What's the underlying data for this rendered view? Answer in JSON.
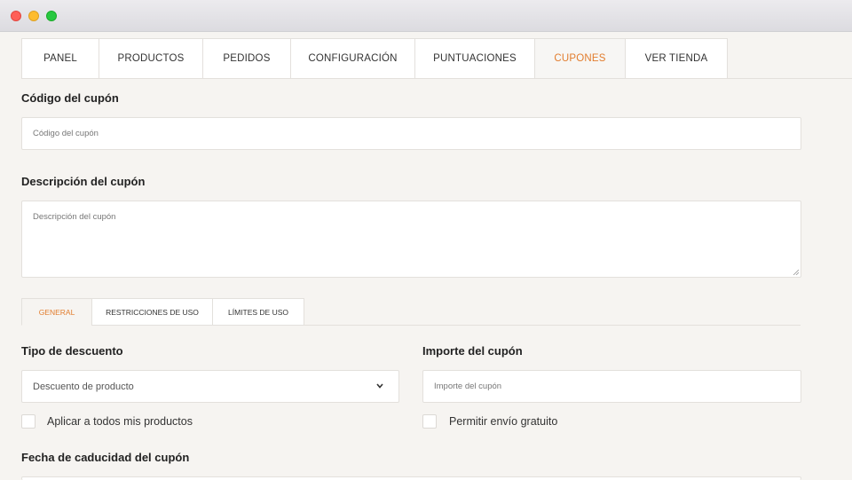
{
  "window": {
    "controls": [
      "close",
      "minimize",
      "maximize"
    ]
  },
  "nav": {
    "tabs": [
      {
        "label": "PANEL"
      },
      {
        "label": "PRODUCTOS"
      },
      {
        "label": "PEDIDOS"
      },
      {
        "label": "CONFIGURACIÓN"
      },
      {
        "label": "PUNTUACIONES"
      },
      {
        "label": "CUPONES",
        "active": true
      },
      {
        "label": "VER TIENDA"
      }
    ],
    "accent_color": "#e27d2e"
  },
  "coupon_code": {
    "label": "Código del cupón",
    "placeholder": "Código del cupón"
  },
  "coupon_description": {
    "label": "Descripción del cupón",
    "placeholder": "Descripción del cupón"
  },
  "subtabs": [
    {
      "label": "GENERAL",
      "active": true
    },
    {
      "label": "RESTRICCIONES DE USO"
    },
    {
      "label": "LÍMITES DE USO"
    }
  ],
  "discount_type": {
    "label": "Tipo de descuento",
    "selected": "Descuento de producto"
  },
  "coupon_amount": {
    "label": "Importe del cupón",
    "placeholder": "Importe del cupón"
  },
  "apply_all": {
    "label": "Aplicar a todos mis productos",
    "checked": false
  },
  "free_shipping": {
    "label": "Permitir envío gratuito",
    "checked": false
  },
  "expiry": {
    "label": "Fecha de caducidad del cupón"
  }
}
